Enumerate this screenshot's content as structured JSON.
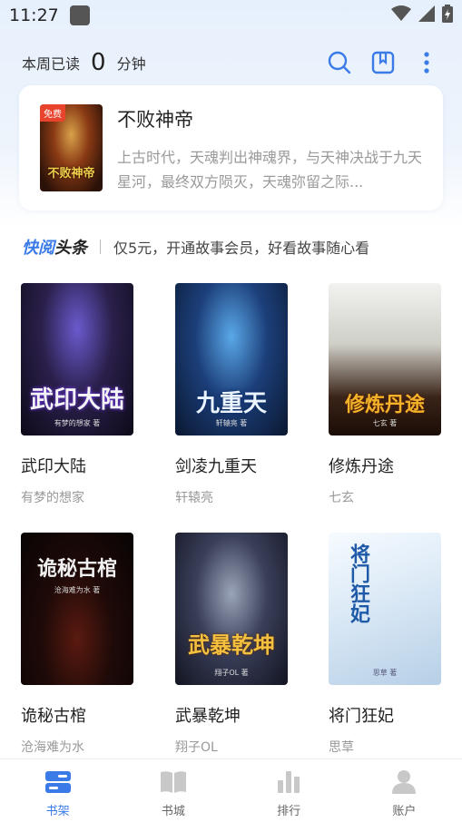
{
  "status_bar": {
    "time": "11:27",
    "icons": [
      "app-icon",
      "wifi-icon",
      "signal-icon",
      "battery-icon"
    ]
  },
  "top_bar": {
    "read_label": "本周已读",
    "read_count": "0",
    "read_unit": "分钟",
    "icons": [
      "search-icon",
      "book-icon",
      "more-icon"
    ]
  },
  "recent_book": {
    "free_tag": "免费",
    "cover_title": "不败神帝",
    "title": "不败神帝",
    "description": "上古时代，天魂判出神魂界，与天神决战于九天星河，最终双方陨灭，天魂弥留之际..."
  },
  "headline": {
    "logo_a": "快阅",
    "logo_b": "头条",
    "text": "仅5元，开通故事会员，好看故事随心看"
  },
  "books": [
    {
      "title": "武印大陆",
      "author": "有梦的想家",
      "cover_title": "武印大陆",
      "cover_author": "有梦的想家 著"
    },
    {
      "title": "剑凌九重天",
      "author": "轩辕亮",
      "cover_title": "九重天",
      "cover_author": "轩辕亮 著"
    },
    {
      "title": "修炼丹途",
      "author": "七玄",
      "cover_title": "修炼丹途",
      "cover_author": "七玄 著"
    },
    {
      "title": "诡秘古棺",
      "author": "沧海难为水",
      "cover_title": "诡秘古棺",
      "cover_author": "沧海难为水 著"
    },
    {
      "title": "武暴乾坤",
      "author": "翔子OL",
      "cover_title": "武暴乾坤",
      "cover_author": "翔子OL 著"
    },
    {
      "title": "将门狂妃",
      "author": "思草",
      "cover_title": "将门狂妃",
      "cover_author": "思草 著"
    }
  ],
  "tabs": [
    {
      "label": "书架",
      "icon": "shelf-icon",
      "active": true
    },
    {
      "label": "书城",
      "icon": "bookstore-icon",
      "active": false
    },
    {
      "label": "排行",
      "icon": "ranking-icon",
      "active": false
    },
    {
      "label": "账户",
      "icon": "account-icon",
      "active": false
    }
  ],
  "colors": {
    "accent": "#3b7be8",
    "free_tag": "#e8432d",
    "background_top": "#e6f0fc"
  }
}
